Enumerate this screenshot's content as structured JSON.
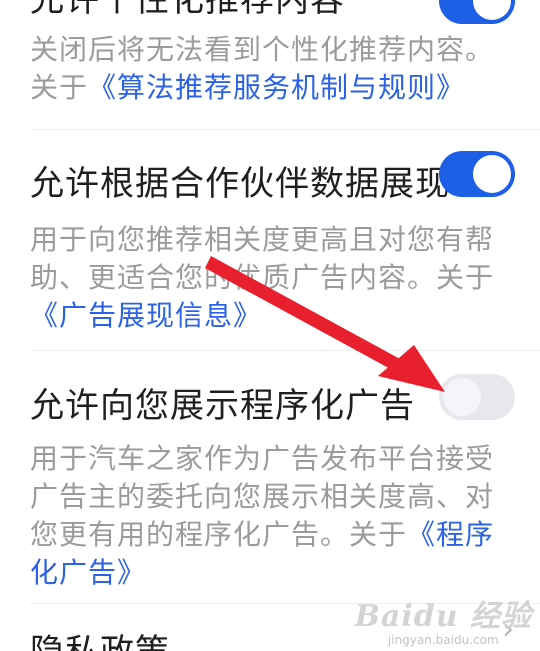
{
  "sections": [
    {
      "title": "允许个性化推荐内容",
      "toggle_on": true,
      "desc_text": "关闭后将无法看到个性化推荐内容。关于",
      "desc_link": "《算法推荐服务机制与规则》"
    },
    {
      "title": "允许根据合作伙伴数据展现",
      "toggle_on": true,
      "desc_text": "用于向您推荐相关度更高且对您有帮助、更适合您的优质广告内容。关于",
      "desc_link": "《广告展现信息》"
    },
    {
      "title": "允许向您展示程序化广告",
      "toggle_on": false,
      "desc_text": "用于汽车之家作为广告发布平台接受广告主的委托向您展示相关度高、对您更有用的程序化广告。关于",
      "desc_link": "《程序化广告》"
    },
    {
      "title": "隐私政策",
      "chevron": "›"
    }
  ],
  "watermark": {
    "logo": "Baidu 经验",
    "sub": "jingyan.baidu.com"
  },
  "colors": {
    "accent": "#1e5fe8",
    "link": "#2c63e6",
    "arrow": "#e8202e"
  }
}
